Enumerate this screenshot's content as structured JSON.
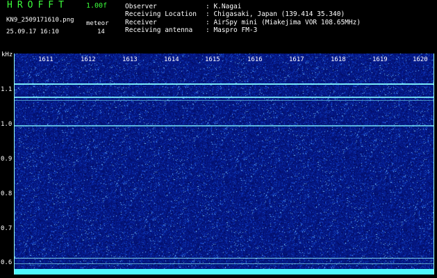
{
  "header": {
    "app_title": "HROFFT",
    "version": "1.00f",
    "filename": "KN9_2509171610.png",
    "meteor_label": "meteor",
    "datetime": "25.09.17 16:10",
    "meteor_count": "14"
  },
  "info": [
    {
      "key": "Observer",
      "value": ": K.Nagai"
    },
    {
      "key": "Receiving Location",
      "value": ": Chigasaki, Japan (139.414 35.340)"
    },
    {
      "key": "Receiver",
      "value": ": AirSpy mini (Miakejima VOR 108.65MHz)"
    },
    {
      "key": "Receiving antenna",
      "value": ": Maspro FM-3"
    }
  ],
  "axis": {
    "unit": "kHz",
    "x_ticks": [
      "1611",
      "1612",
      "1613",
      "1614",
      "1615",
      "1616",
      "1617",
      "1618",
      "1619",
      "1620"
    ],
    "y_ticks": [
      "1.1",
      "1.0",
      "0.9",
      "0.8",
      "0.7",
      "0.6"
    ]
  },
  "colors": {
    "background": "#051a8c",
    "signal": "#7ff6ff",
    "header_green": "#3cff3c"
  }
}
